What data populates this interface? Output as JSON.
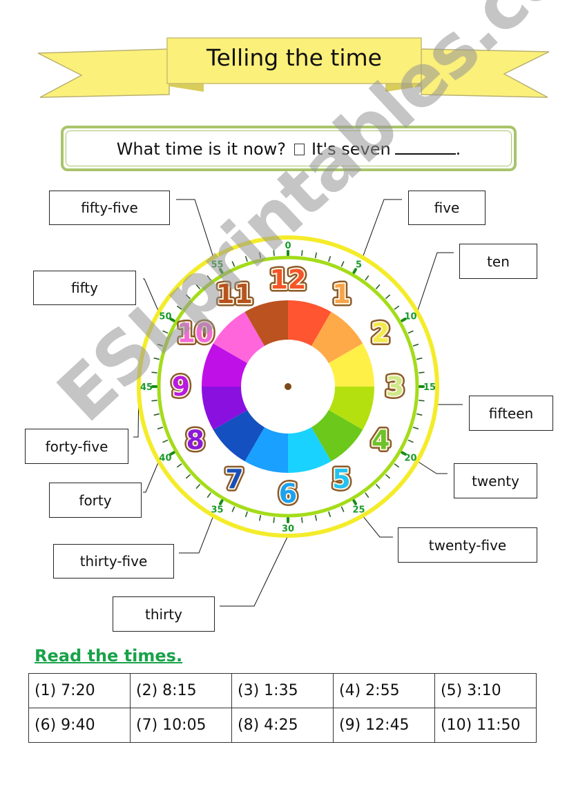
{
  "banner": {
    "title": "Telling the time",
    "color": "#fbf07a"
  },
  "question": {
    "prompt": "What time is it now?",
    "answer_prefix": "It's seven",
    "answer_suffix": "."
  },
  "clock": {
    "hour_numbers": [
      {
        "label": "12",
        "color": "#f4542a"
      },
      {
        "label": "1",
        "color": "#f7a54a"
      },
      {
        "label": "2",
        "color": "#f2ea4a"
      },
      {
        "label": "3",
        "color": "#cfe88a"
      },
      {
        "label": "4",
        "color": "#6cc22a"
      },
      {
        "label": "5",
        "color": "#22c2f2"
      },
      {
        "label": "6",
        "color": "#1aa2f2"
      },
      {
        "label": "7",
        "color": "#1a4fb8"
      },
      {
        "label": "8",
        "color": "#8a1ad8"
      },
      {
        "label": "9",
        "color": "#b81ae0"
      },
      {
        "label": "10",
        "color": "#f468d8"
      },
      {
        "label": "11",
        "color": "#b8531f"
      }
    ],
    "segment_colors": [
      "#ff5530",
      "#ffaa48",
      "#fff048",
      "#b4e010",
      "#6cc81a",
      "#1ad2ff",
      "#1aa0ff",
      "#1450c0",
      "#8a10e0",
      "#c010e8",
      "#ff66dc",
      "#bb5220"
    ],
    "minute_labels": [
      "0",
      "5",
      "10",
      "15",
      "20",
      "25",
      "30",
      "35",
      "40",
      "45",
      "50",
      "55"
    ],
    "minute_label_color": "#1a9a2a",
    "outer_ring_color": "#f4ec2a",
    "inner_ring_color": "#a4dc1a",
    "hub_color": "#7a4a1a"
  },
  "labels": [
    {
      "minute": 55,
      "text": "fifty-five"
    },
    {
      "minute": 5,
      "text": "five"
    },
    {
      "minute": 10,
      "text": "ten"
    },
    {
      "minute": 50,
      "text": "fifty"
    },
    {
      "minute": 15,
      "text": "fifteen"
    },
    {
      "minute": 45,
      "text": "forty-five"
    },
    {
      "minute": 20,
      "text": "twenty"
    },
    {
      "minute": 40,
      "text": "forty"
    },
    {
      "minute": 25,
      "text": "twenty-five"
    },
    {
      "minute": 35,
      "text": "thirty-five"
    },
    {
      "minute": 30,
      "text": "thirty"
    }
  ],
  "exercise": {
    "heading": "Read the times.",
    "rows": [
      [
        "(1) 7:20",
        "(2) 8:15",
        "(3) 1:35",
        "(4) 2:55",
        "(5) 3:10"
      ],
      [
        "(6) 9:40",
        "(7) 10:05",
        "(8) 4:25",
        "(9) 12:45",
        "(10) 11:50"
      ]
    ]
  },
  "watermark": "ESLprintables.com"
}
